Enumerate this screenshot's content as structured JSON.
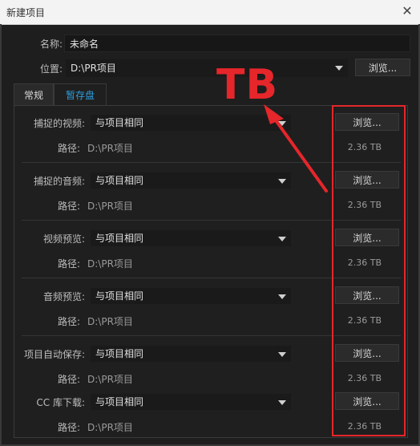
{
  "window": {
    "title": "新建项目"
  },
  "general": {
    "name_label": "名称:",
    "name_value": "未命名",
    "location_label": "位置:",
    "location_value": "D:\\PR项目",
    "browse_label": "浏览..."
  },
  "tabs": [
    {
      "label": "常规"
    },
    {
      "label": "暂存盘"
    }
  ],
  "rows": [
    {
      "label": "捕捉的视频:",
      "dropdown": "与项目相同",
      "browse": "浏览...",
      "path_label": "路径:",
      "path": "D:\\PR项目",
      "space": "2.36 TB"
    },
    {
      "label": "捕捉的音频:",
      "dropdown": "与项目相同",
      "browse": "浏览...",
      "path_label": "路径:",
      "path": "D:\\PR项目",
      "space": "2.36 TB"
    },
    {
      "label": "视频预览:",
      "dropdown": "与项目相同",
      "browse": "浏览...",
      "path_label": "路径:",
      "path": "D:\\PR项目",
      "space": "2.36 TB"
    },
    {
      "label": "音频预览:",
      "dropdown": "与项目相同",
      "browse": "浏览...",
      "path_label": "路径:",
      "path": "D:\\PR项目",
      "space": "2.36 TB"
    },
    {
      "label": "项目自动保存:",
      "dropdown": "与项目相同",
      "browse": "浏览...",
      "path_label": "路径:",
      "path": "D:\\PR项目",
      "space": "2.36 TB"
    },
    {
      "label": "CC 库下载:",
      "dropdown": "与项目相同",
      "browse": "浏览...",
      "path_label": "路径:",
      "path": "D:\\PR项目",
      "space": "2.36 TB"
    }
  ],
  "annotation": {
    "text": "TB",
    "color": "#e5262b"
  },
  "colors": {
    "accent_tab": "#2d9cdb",
    "background": "#1e1e1e"
  }
}
